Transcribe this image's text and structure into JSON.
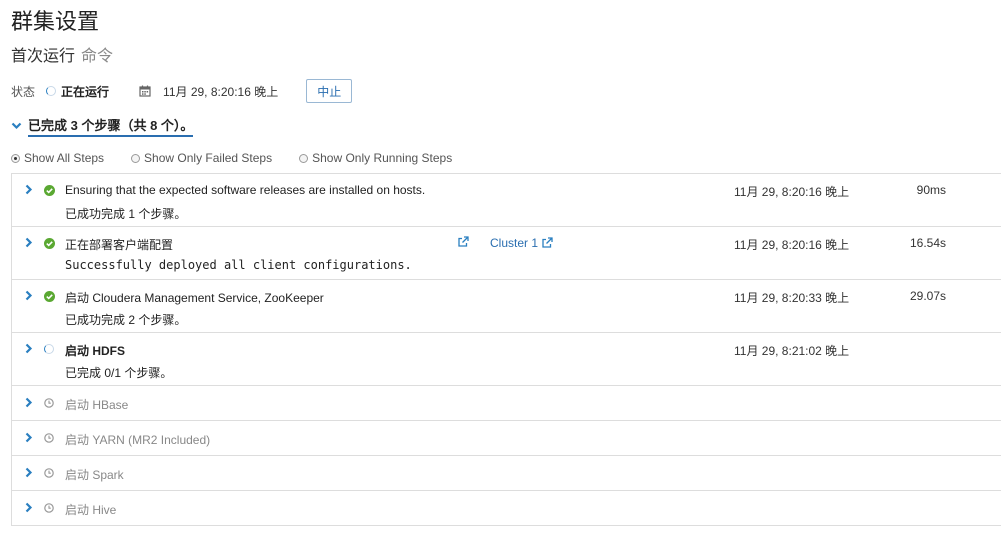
{
  "title": "群集设置",
  "subtitle": {
    "main": "首次运行",
    "muted": "命令"
  },
  "status": {
    "label": "状态",
    "value": "正在运行",
    "timestamp": "11月 29, 8:20:16 晚上",
    "abort_label": "中止"
  },
  "summary": "已完成 3 个步骤（共 8 个）。",
  "filters": [
    {
      "label": "Show All Steps",
      "selected": true
    },
    {
      "label": "Show Only Failed Steps",
      "selected": false
    },
    {
      "label": "Show Only Running Steps",
      "selected": false
    }
  ],
  "steps": [
    {
      "name": "Ensuring that the expected software releases are installed on hosts.",
      "detail": "已成功完成 1 个步骤。",
      "time": "11月 29, 8:20:16 晚上",
      "duration": "90ms",
      "state": "success"
    },
    {
      "name": "正在部署客户端配置",
      "detail": "Successfully deployed all client configurations.",
      "time": "11月 29, 8:20:16 晚上",
      "duration": "16.54s",
      "state": "success",
      "link": "Cluster 1"
    },
    {
      "name": "启动 Cloudera Management Service, ZooKeeper",
      "detail": "已成功完成 2 个步骤。",
      "time": "11月 29, 8:20:33 晚上",
      "duration": "29.07s",
      "state": "success"
    },
    {
      "name": "启动 HDFS",
      "detail": "已完成 0/1 个步骤。",
      "time": "11月 29, 8:21:02 晚上",
      "duration": "",
      "state": "running"
    },
    {
      "name": "启动 HBase",
      "state": "pending"
    },
    {
      "name": "启动 YARN (MR2 Included)",
      "state": "pending"
    },
    {
      "name": "启动 Spark",
      "state": "pending"
    },
    {
      "name": "启动 Hive",
      "state": "pending"
    }
  ],
  "colors": {
    "success": "#5aa832",
    "accent": "#2a7fc0",
    "pending": "#999999"
  }
}
